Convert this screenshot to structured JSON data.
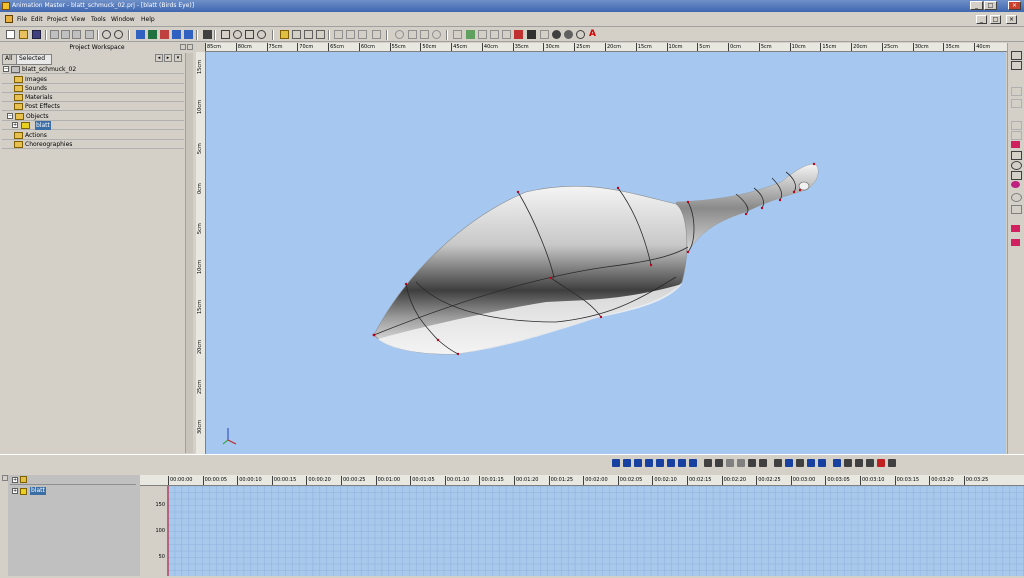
{
  "window": {
    "title": "Animation Master - blatt_schmuck_02.prj - [blatt (Birds Eye)]",
    "controls": [
      "_",
      "□",
      "×"
    ]
  },
  "menu": {
    "items": [
      "File",
      "Edit",
      "Project",
      "View",
      "Tools",
      "Window",
      "Help"
    ],
    "mdi_controls": [
      "_",
      "□",
      "×"
    ]
  },
  "workspace": {
    "title": "Project Workspace",
    "tabs": [
      "All",
      "Selected"
    ],
    "tree": [
      {
        "label": "blatt_schmuck_02",
        "level": 0,
        "icon": "project-icon"
      },
      {
        "label": "Images",
        "level": 1,
        "icon": "folder-icon"
      },
      {
        "label": "Sounds",
        "level": 1,
        "icon": "folder-icon"
      },
      {
        "label": "Materials",
        "level": 1,
        "icon": "folder-icon"
      },
      {
        "label": "Post Effects",
        "level": 1,
        "icon": "folder-icon"
      },
      {
        "label": "Objects",
        "level": 0,
        "icon": "folder-icon"
      },
      {
        "label": "blatt",
        "level": 1,
        "icon": "model-icon",
        "selected": true
      },
      {
        "label": "Actions",
        "level": 1,
        "icon": "folder-icon"
      },
      {
        "label": "Choreographies",
        "level": 1,
        "icon": "folder-icon"
      }
    ]
  },
  "ruler": {
    "h_labels": [
      "85cm",
      "80cm",
      "75cm",
      "70cm",
      "65cm",
      "60cm",
      "55cm",
      "50cm",
      "45cm",
      "40cm",
      "35cm",
      "30cm",
      "25cm",
      "20cm",
      "15cm",
      "10cm",
      "5cm",
      "0cm",
      "5cm",
      "10cm",
      "15cm",
      "20cm",
      "25cm",
      "30cm",
      "35cm",
      "40cm"
    ],
    "v_labels": [
      "15cm",
      "10cm",
      "5cm",
      "0cm",
      "5cm",
      "10cm",
      "15cm",
      "20cm",
      "25cm",
      "30cm"
    ]
  },
  "timeline": {
    "ticks": [
      "00:00:00",
      "00:00:05",
      "00:00:10",
      "00:00:15",
      "00:00:20",
      "00:00:25",
      "00:01:00",
      "00:01:05",
      "00:01:10",
      "00:01:15",
      "00:01:20",
      "00:01:25",
      "00:02:00",
      "00:02:05",
      "00:02:10",
      "00:02:15",
      "00:02:20",
      "00:02:25",
      "00:03:00",
      "00:03:05",
      "00:03:10",
      "00:03:15",
      "00:03:20",
      "00:03:25"
    ],
    "y_labels": [
      "150",
      "100",
      "50"
    ],
    "track": "blatt"
  },
  "colors": {
    "viewport_bg": "#a6c8f0",
    "spline": "#c00018",
    "accent": "#3a6ea5"
  }
}
